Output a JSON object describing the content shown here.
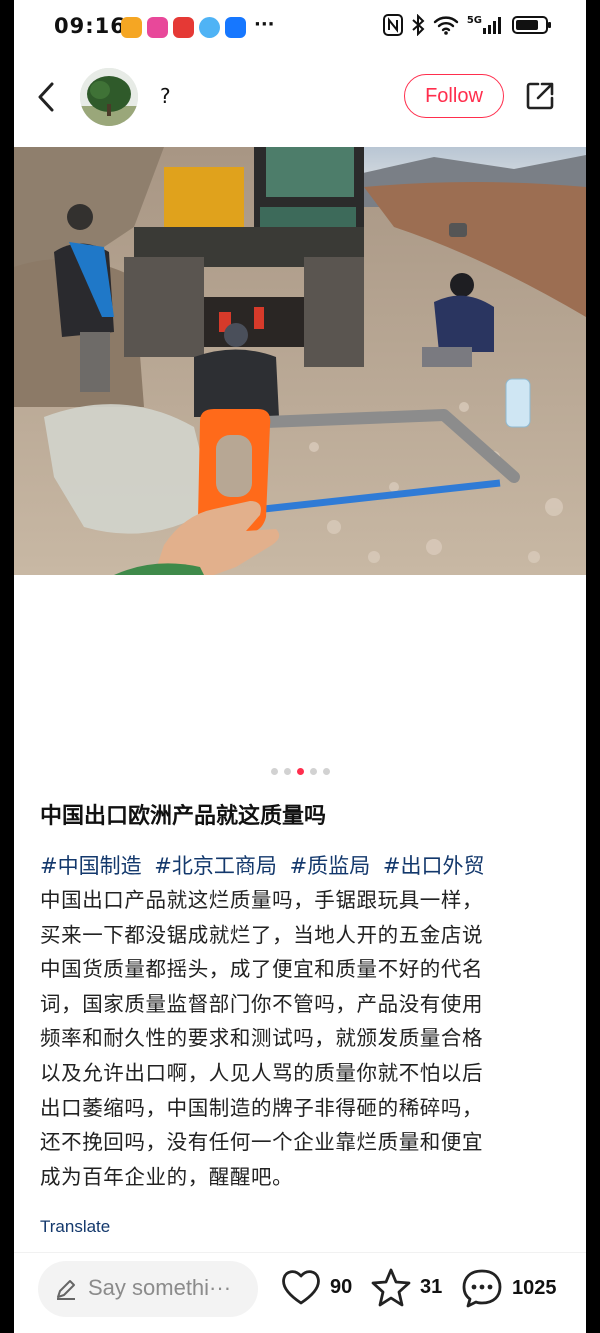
{
  "status_bar": {
    "time": "09:16",
    "more": "···",
    "network_badge": "5G",
    "app_colors": [
      "#f5a623",
      "#e8489a",
      "#e53935",
      "#2196f3",
      "#1677ff"
    ]
  },
  "header": {
    "username": "?",
    "follow_label": "Follow"
  },
  "carousel": {
    "total": 5,
    "active_index": 2
  },
  "post": {
    "title": "中国出口欧洲产品就这质量吗",
    "tags": [
      "#中国制造",
      "#北京工商局",
      "#质监局",
      "#出口外贸"
    ],
    "body_lines": [
      "中国出口产品就这烂质量吗，手锯跟玩具一样，",
      "买来一下都没锯成就烂了，当地人开的五金店说",
      "中国货质量都摇头，成了便宜和质量不好的代名",
      "词，国家质量监督部门你不管吗，产品没有使用",
      "频率和耐久性的要求和测试吗，就颁发质量合格",
      "以及允许出口啊，人见人骂的质量你就不怕以后",
      "出口萎缩吗，中国制造的牌子非得砸的稀碎吗，",
      "还不挽回吗，没有任何一个企业靠烂质量和便宜",
      "成为百年企业的，醒醒吧。"
    ],
    "translate_label": "Translate"
  },
  "bottom_bar": {
    "comment_placeholder": "Say somethi···",
    "likes": "90",
    "favorites": "31",
    "comments": "1025"
  },
  "colors": {
    "accent": "#ff2e4d",
    "tag": "#13386c",
    "saw_handle": "#ff6a1a",
    "saw_blade": "#2f7bd6"
  }
}
